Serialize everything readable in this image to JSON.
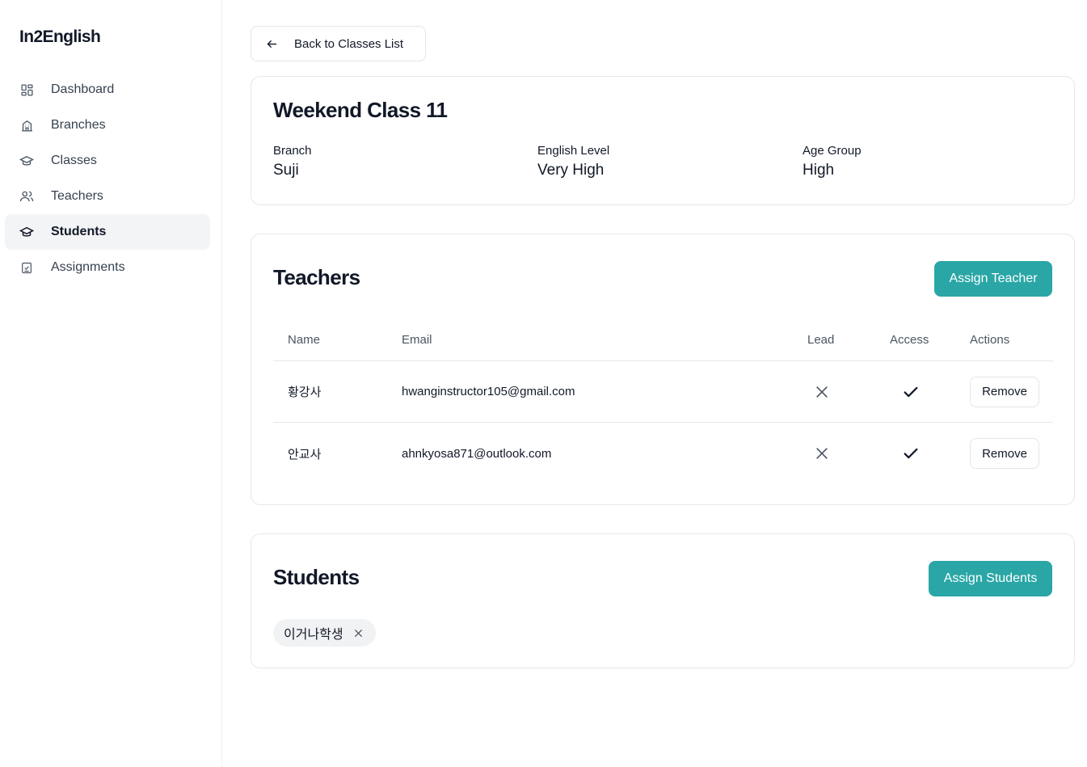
{
  "app": {
    "title": "In2English"
  },
  "sidebar": {
    "items": [
      {
        "label": "Dashboard",
        "icon": "dashboard-icon"
      },
      {
        "label": "Branches",
        "icon": "branch-building-icon"
      },
      {
        "label": "Classes",
        "icon": "graduation-cap-icon"
      },
      {
        "label": "Teachers",
        "icon": "users-icon"
      },
      {
        "label": "Students",
        "icon": "graduation-cap-icon",
        "active": true
      },
      {
        "label": "Assignments",
        "icon": "clipboard-check-icon"
      }
    ]
  },
  "back": {
    "label": "Back to Classes List"
  },
  "class_info": {
    "title": "Weekend Class 11",
    "branch_label": "Branch",
    "branch_value": "Suji",
    "level_label": "English Level",
    "level_value": "Very High",
    "age_label": "Age Group",
    "age_value": "High"
  },
  "teachers": {
    "title": "Teachers",
    "assign_label": "Assign Teacher",
    "columns": [
      "Name",
      "Email",
      "Lead",
      "Access",
      "Actions"
    ],
    "rows": [
      {
        "name": "황강사",
        "email": "hwanginstructor105@gmail.com",
        "lead": false,
        "access": true,
        "action": "Remove"
      },
      {
        "name": "안교사",
        "email": "ahnkyosa871@outlook.com",
        "lead": false,
        "access": true,
        "action": "Remove"
      }
    ]
  },
  "students": {
    "title": "Students",
    "assign_label": "Assign Students",
    "chips": [
      "이거나학생"
    ]
  },
  "colors": {
    "accent": "#2aa6a6",
    "active_nav_bg": "#f3f4f6",
    "border": "#e5e7eb"
  }
}
